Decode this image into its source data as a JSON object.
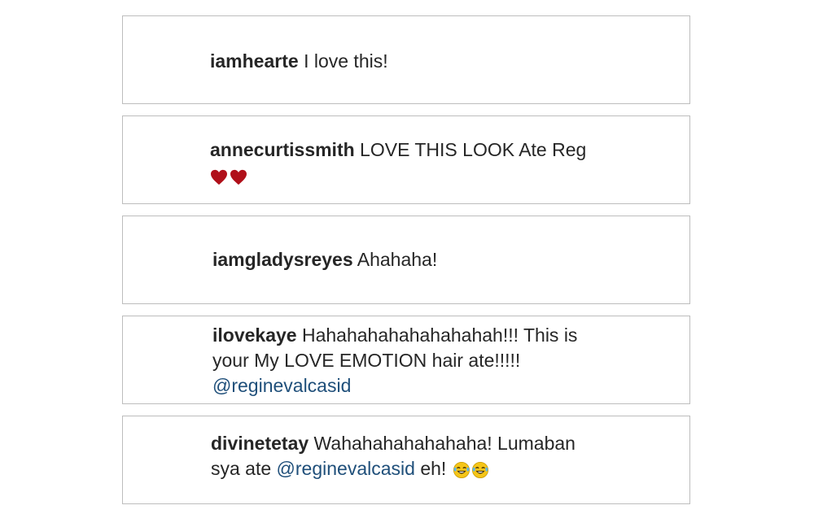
{
  "comments": [
    {
      "username": "iamhearte",
      "text": "I love this!"
    },
    {
      "username": "annecurtissmith",
      "text": "LOVE THIS LOOK Ate Reg",
      "emoji": [
        "red-heart",
        "red-heart"
      ]
    },
    {
      "username": "iamgladysreyes",
      "text": "Ahahaha!"
    },
    {
      "username": "ilovekaye",
      "text": "Hahahahahahahahahah!!! This is your My LOVE EMOTION hair ate!!!!!",
      "mention": "@reginevalcasid"
    },
    {
      "username": "divinetetay",
      "text": "Wahahahahahahaha! Lumaban sya ate",
      "mention": "@reginevalcasid",
      "text_after": "eh!",
      "emoji": [
        "tears-of-joy",
        "tears-of-joy"
      ]
    }
  ],
  "colors": {
    "border": "#bdbdbd",
    "text": "#262626",
    "mention": "#1f4f7a",
    "heart": "#b0101a",
    "emoji_face": "#f5c518"
  }
}
